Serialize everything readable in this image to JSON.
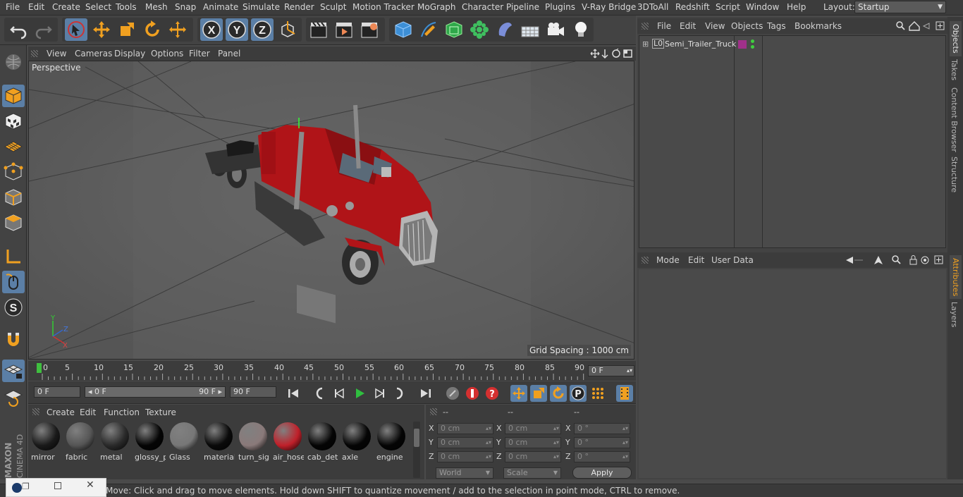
{
  "menubar": {
    "items": [
      "File",
      "Edit",
      "Create",
      "Select",
      "Tools",
      "Mesh",
      "Snap",
      "Animate",
      "Simulate",
      "Render",
      "Sculpt",
      "Motion Tracker",
      "MoGraph",
      "Character",
      "Pipeline",
      "Plugins",
      "V-Ray Bridge",
      "3DToAll",
      "Redshift",
      "Script",
      "Window",
      "Help"
    ],
    "layout_label": "Layout:",
    "layout_value": "Startup"
  },
  "viewport": {
    "menu": [
      "View",
      "Cameras",
      "Display",
      "Options",
      "Filter",
      "Panel"
    ],
    "label": "Perspective",
    "grid_spacing": "Grid Spacing : 1000 cm"
  },
  "timeline": {
    "ticks": [
      "0",
      "5",
      "10",
      "15",
      "20",
      "25",
      "30",
      "35",
      "40",
      "45",
      "50",
      "55",
      "60",
      "65",
      "70",
      "75",
      "80",
      "85",
      "90"
    ],
    "current_frame": "0 F",
    "start_frame": "0 F",
    "range_start": "0 F",
    "range_end": "90 F",
    "end_frame": "90 F"
  },
  "materials": {
    "menu": [
      "Create",
      "Edit",
      "Function",
      "Texture"
    ],
    "items": [
      {
        "name": "mirror",
        "color": "#1a1a1a"
      },
      {
        "name": "fabric",
        "color": "#555555"
      },
      {
        "name": "metal",
        "color": "#2a2a2a"
      },
      {
        "name": "glossy_p",
        "color": "#050505"
      },
      {
        "name": "Glass",
        "color": "#777777"
      },
      {
        "name": "material",
        "color": "#0a0a0a"
      },
      {
        "name": "turn_sig",
        "color": "#8a7a7a"
      },
      {
        "name": "air_hose",
        "color": "#c0202a"
      },
      {
        "name": "cab_det",
        "color": "#050505"
      },
      {
        "name": "axle",
        "color": "#050505"
      },
      {
        "name": "engine",
        "color": "#050505"
      }
    ]
  },
  "coordinates": {
    "headers": [
      "--",
      "--",
      "--"
    ],
    "rows": [
      {
        "a": "X",
        "av": "0 cm",
        "b": "X",
        "bv": "0 cm",
        "c": "X",
        "cv": "0 °"
      },
      {
        "a": "Y",
        "av": "0 cm",
        "b": "Y",
        "bv": "0 cm",
        "c": "Y",
        "cv": "0 °"
      },
      {
        "a": "Z",
        "av": "0 cm",
        "b": "Z",
        "bv": "0 cm",
        "c": "Z",
        "cv": "0 °"
      }
    ],
    "world": "World",
    "scale": "Scale",
    "apply": "Apply"
  },
  "objects": {
    "menu": [
      "File",
      "Edit",
      "View",
      "Objects",
      "Tags",
      "Bookmarks"
    ],
    "items": [
      {
        "name": "Semi_Trailer_Truck",
        "tag_color": "#a0308a"
      }
    ]
  },
  "attributes": {
    "menu": [
      "Mode",
      "Edit",
      "User Data"
    ]
  },
  "side_tabs": [
    "Objects",
    "Takes",
    "Content Browser",
    "Structure",
    "Attributes",
    "Layers"
  ],
  "status": {
    "message": "Move: Click and drag to move elements. Hold down SHIFT to quantize movement / add to the selection in point mode, CTRL to remove."
  },
  "brand": {
    "line1": "MAXON",
    "line2": "CINEMA 4D"
  },
  "colors": {
    "accent": "#3d8fd6",
    "truck": "#b01418",
    "play": "#2fbf3f",
    "record": "#d43030"
  }
}
